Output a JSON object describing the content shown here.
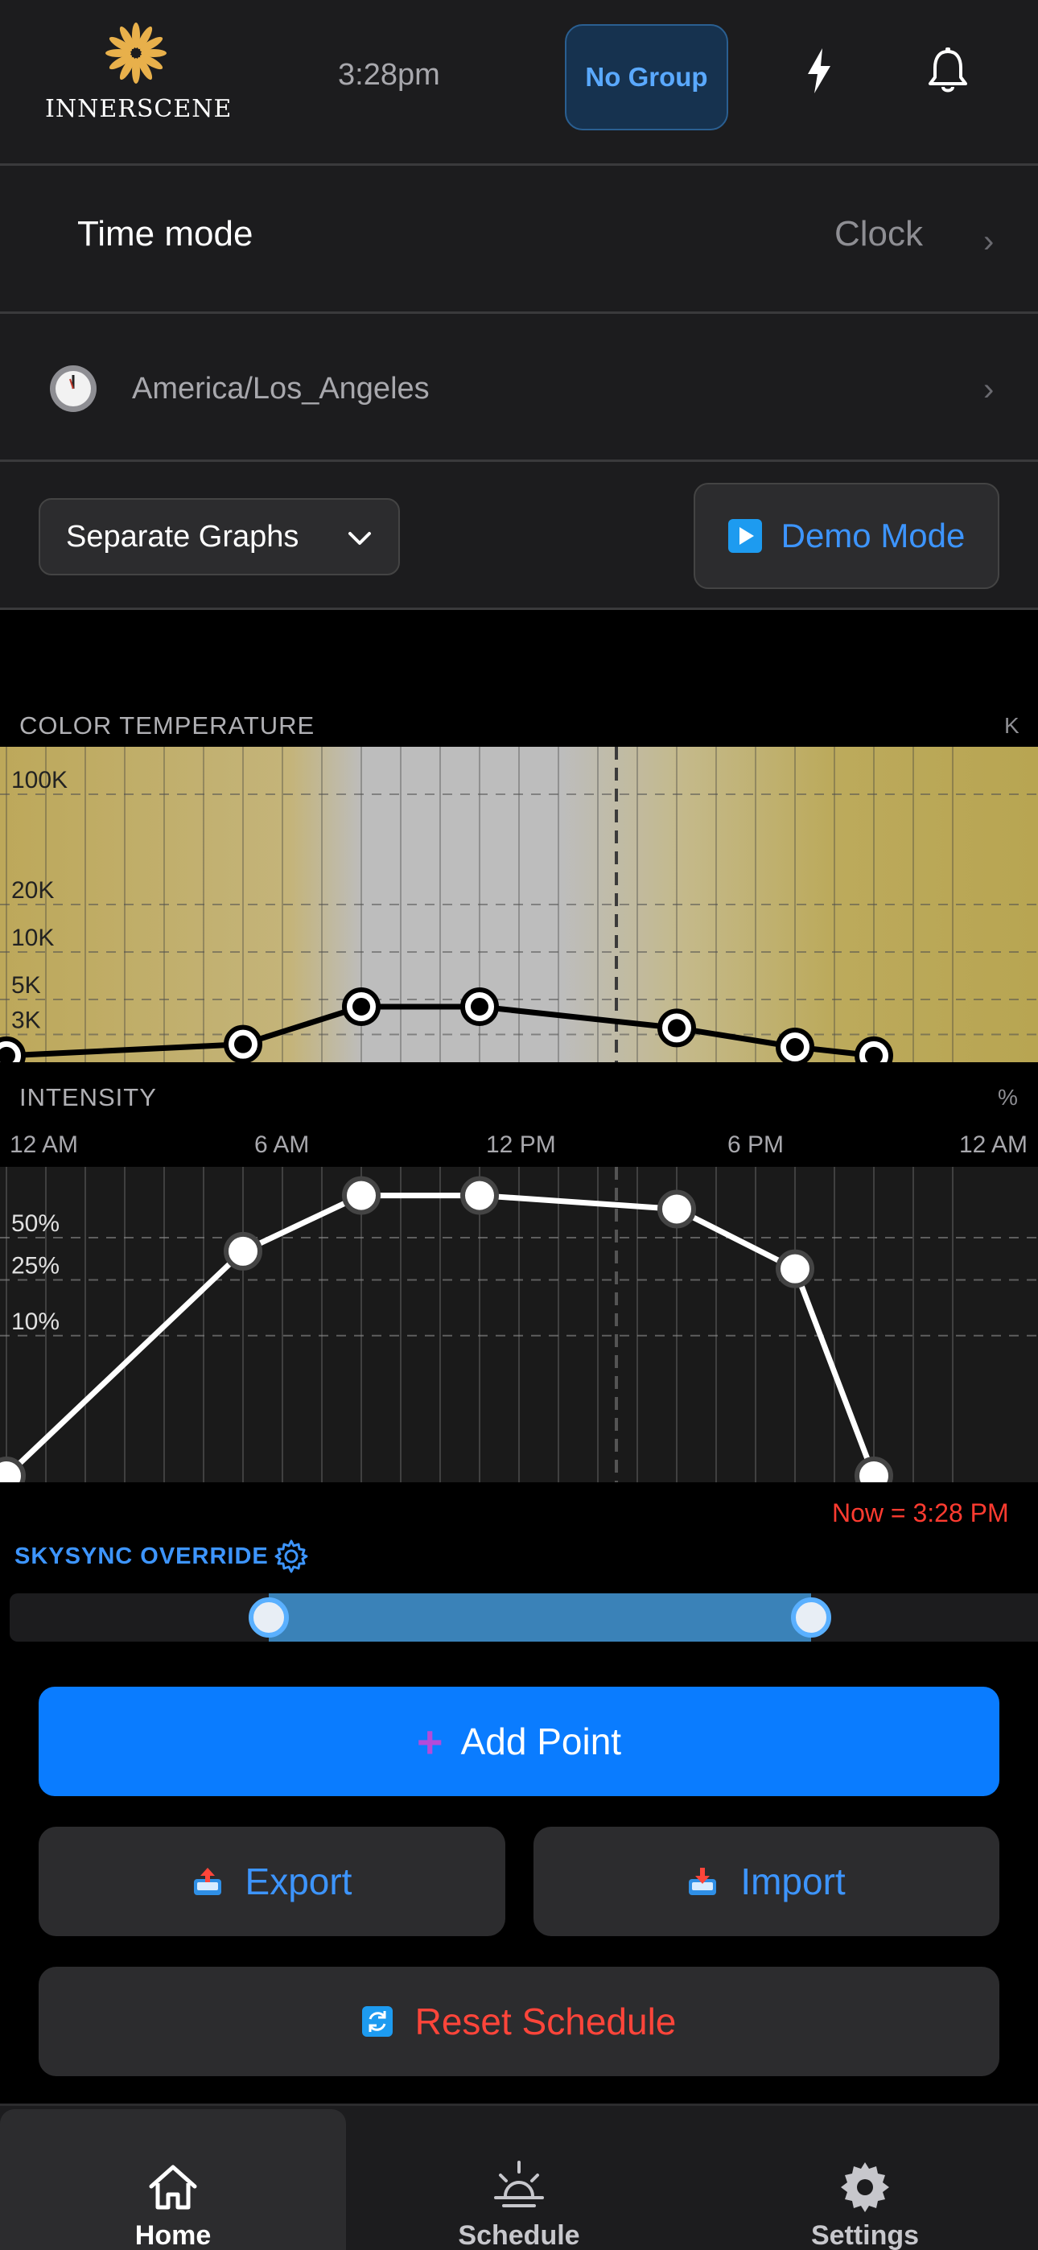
{
  "header": {
    "logo_text": "INNERSCENE",
    "time": "3:28pm",
    "group_button": "No Group",
    "colors": {
      "accent": "#0a7cff",
      "logo_gold": "#e8b04b"
    }
  },
  "time_mode": {
    "label": "Time mode",
    "value": "Clock",
    "chevron": "›"
  },
  "timezone": {
    "value": "America/Los_Angeles",
    "chevron": "›"
  },
  "controls": {
    "graph_select": "Separate Graphs",
    "demo_button": "Demo Mode"
  },
  "graphs": {
    "color_temperature": {
      "label": "COLOR TEMPERATURE",
      "unit": "K",
      "y_labels": [
        "100K",
        "20K",
        "10K",
        "5K",
        "3K"
      ]
    },
    "intensity": {
      "label": "INTENSITY",
      "unit": "%",
      "y_labels": [
        "50%",
        "25%",
        "10%"
      ]
    },
    "x_ticks": [
      "12 AM",
      "6 AM",
      "12 PM",
      "6 PM",
      "12 AM"
    ]
  },
  "chart_data": [
    {
      "type": "line",
      "title": "COLOR TEMPERATURE",
      "ylabel": "K",
      "x_unit": "hours",
      "x": [
        0,
        6,
        9,
        12,
        17,
        20,
        22
      ],
      "values": [
        2200,
        2600,
        4500,
        4500,
        3300,
        2500,
        2200
      ],
      "y_scale": "log",
      "y_ticks": [
        3000,
        5000,
        10000,
        20000,
        100000
      ],
      "xlim": [
        0,
        24
      ],
      "grid": true,
      "now_marker": 15.47
    },
    {
      "type": "line",
      "title": "INTENSITY",
      "ylabel": "%",
      "x_unit": "hours",
      "x": [
        0,
        6,
        9,
        12,
        17,
        20,
        22
      ],
      "values": [
        1,
        40,
        100,
        100,
        80,
        30,
        1
      ],
      "y_scale": "log",
      "y_ticks": [
        10,
        25,
        50
      ],
      "xlim": [
        0,
        24
      ],
      "grid": true,
      "now_marker": 15.47
    }
  ],
  "now_label": "Now = 3:28 PM",
  "skysync": {
    "label": "SKYSYNC OVERRIDE",
    "range_start": 6.25,
    "range_end": 19.3
  },
  "actions": {
    "add_point": "Add Point",
    "add_icon": "+",
    "export": "Export",
    "import": "Import",
    "reset": "Reset Schedule"
  },
  "tabs": [
    {
      "label": "Home",
      "icon": "home-icon",
      "active": true
    },
    {
      "label": "Schedule",
      "icon": "sunrise-icon",
      "active": false
    },
    {
      "label": "Settings",
      "icon": "gear-icon",
      "active": false
    }
  ]
}
